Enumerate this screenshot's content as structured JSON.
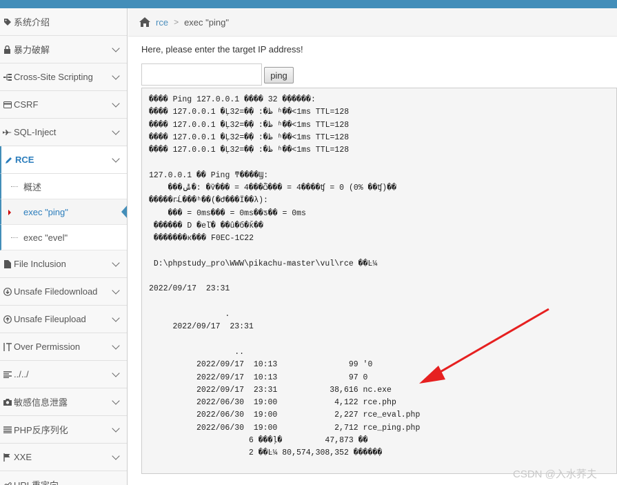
{
  "sidebar": {
    "items": [
      {
        "label": "系统介绍",
        "icon": "tag-icon",
        "chevron": false
      },
      {
        "label": "暴力破解",
        "icon": "lock-icon",
        "chevron": true
      },
      {
        "label": "Cross-Site Scripting",
        "icon": "sitemap-icon",
        "chevron": true
      },
      {
        "label": "CSRF",
        "icon": "credit-card-icon",
        "chevron": true
      },
      {
        "label": "SQL-Inject",
        "icon": "fighter-jet-icon",
        "chevron": true
      },
      {
        "label": "RCE",
        "icon": "pencil-icon",
        "chevron": true,
        "active": true
      },
      {
        "label": "File Inclusion",
        "icon": "file-icon",
        "chevron": true
      },
      {
        "label": "Unsafe Filedownload",
        "icon": "download-icon",
        "chevron": true
      },
      {
        "label": "Unsafe Fileupload",
        "icon": "upload-icon",
        "chevron": true
      },
      {
        "label": "Over Permission",
        "icon": "text-cursor-icon",
        "chevron": true
      },
      {
        "label": "../../",
        "icon": "align-left-icon",
        "chevron": true
      },
      {
        "label": "敏感信息泄露",
        "icon": "camera-icon",
        "chevron": true
      },
      {
        "label": "PHP反序列化",
        "icon": "list-icon",
        "chevron": true
      },
      {
        "label": "XXE",
        "icon": "flag-icon",
        "chevron": true
      },
      {
        "label": "URL重定向",
        "icon": "link-icon",
        "chevron": false
      }
    ],
    "rce_sub": [
      {
        "label": "概述"
      },
      {
        "label": "exec \"ping\"",
        "active": true
      },
      {
        "label": "exec \"evel\""
      }
    ]
  },
  "breadcrumb": {
    "link": "rce",
    "separator": ">",
    "current": "exec \"ping\""
  },
  "form": {
    "prompt": "Here, please enter the target IP address!",
    "input_value": "",
    "button_label": "ping"
  },
  "output_text": "���� Ping 127.0.0.1 ���� 32 �ֽ�����:\n���� 127.0.0.1 �Ļظ�: �ֽ�=32 ʱ��<1ms TTL=128\n���� 127.0.0.1 �Ļظ�: �ֽ�=32 ʱ��<1ms TTL=128\n���� 127.0.0.1 �Ļظ�: �ֽ�=32 ʱ��<1ms TTL=128\n���� 127.0.0.1 �Ļظ�: �ֽ�=32 ʱ��<1ms TTL=128\n\n127.0.0.1 �� Ping ͳ����Ϣ:\n    ���ݰ�: �ѷ��� = 4���ѽ��� = 4����ʧ = 0 (0% ��ʧ)��\n�����г̵Ĺ���ʱ��(�Ժ���Ϊ��λ):\n    ��� = 0ms��� = 0ms��ƽ�� = 0ms\n ������ D �еľ� ��û�б�ǩ��\n �������к��� F0EC-1C22\n\n D:\\phpstudy_pro\\WWW\\pikachu-master\\vul\\rce ��Ŀ¼\n\n2022/09/17  23:31\n\n                .\n     2022/09/17  23:31\n\n                  ..\n          2022/09/17  10:13               99 '0\n          2022/09/17  10:13               97 0\n          2022/09/17  23:31           38,616 nc.exe\n          2022/06/30  19:00            4,122 rce.php\n          2022/06/30  19:00            2,227 rce_eval.php\n          2022/06/30  19:00            2,712 rce_ping.php\n                     6 ���ļ�         47,873 ��\n                     2 ��Ŀ¼ 80,574,308,352 �����ֽ�",
  "watermark": "CSDN @入水荞夫",
  "colors": {
    "accent": "#438eb9",
    "link": "#4c8fbd",
    "annotation_arrow": "#e62020"
  }
}
